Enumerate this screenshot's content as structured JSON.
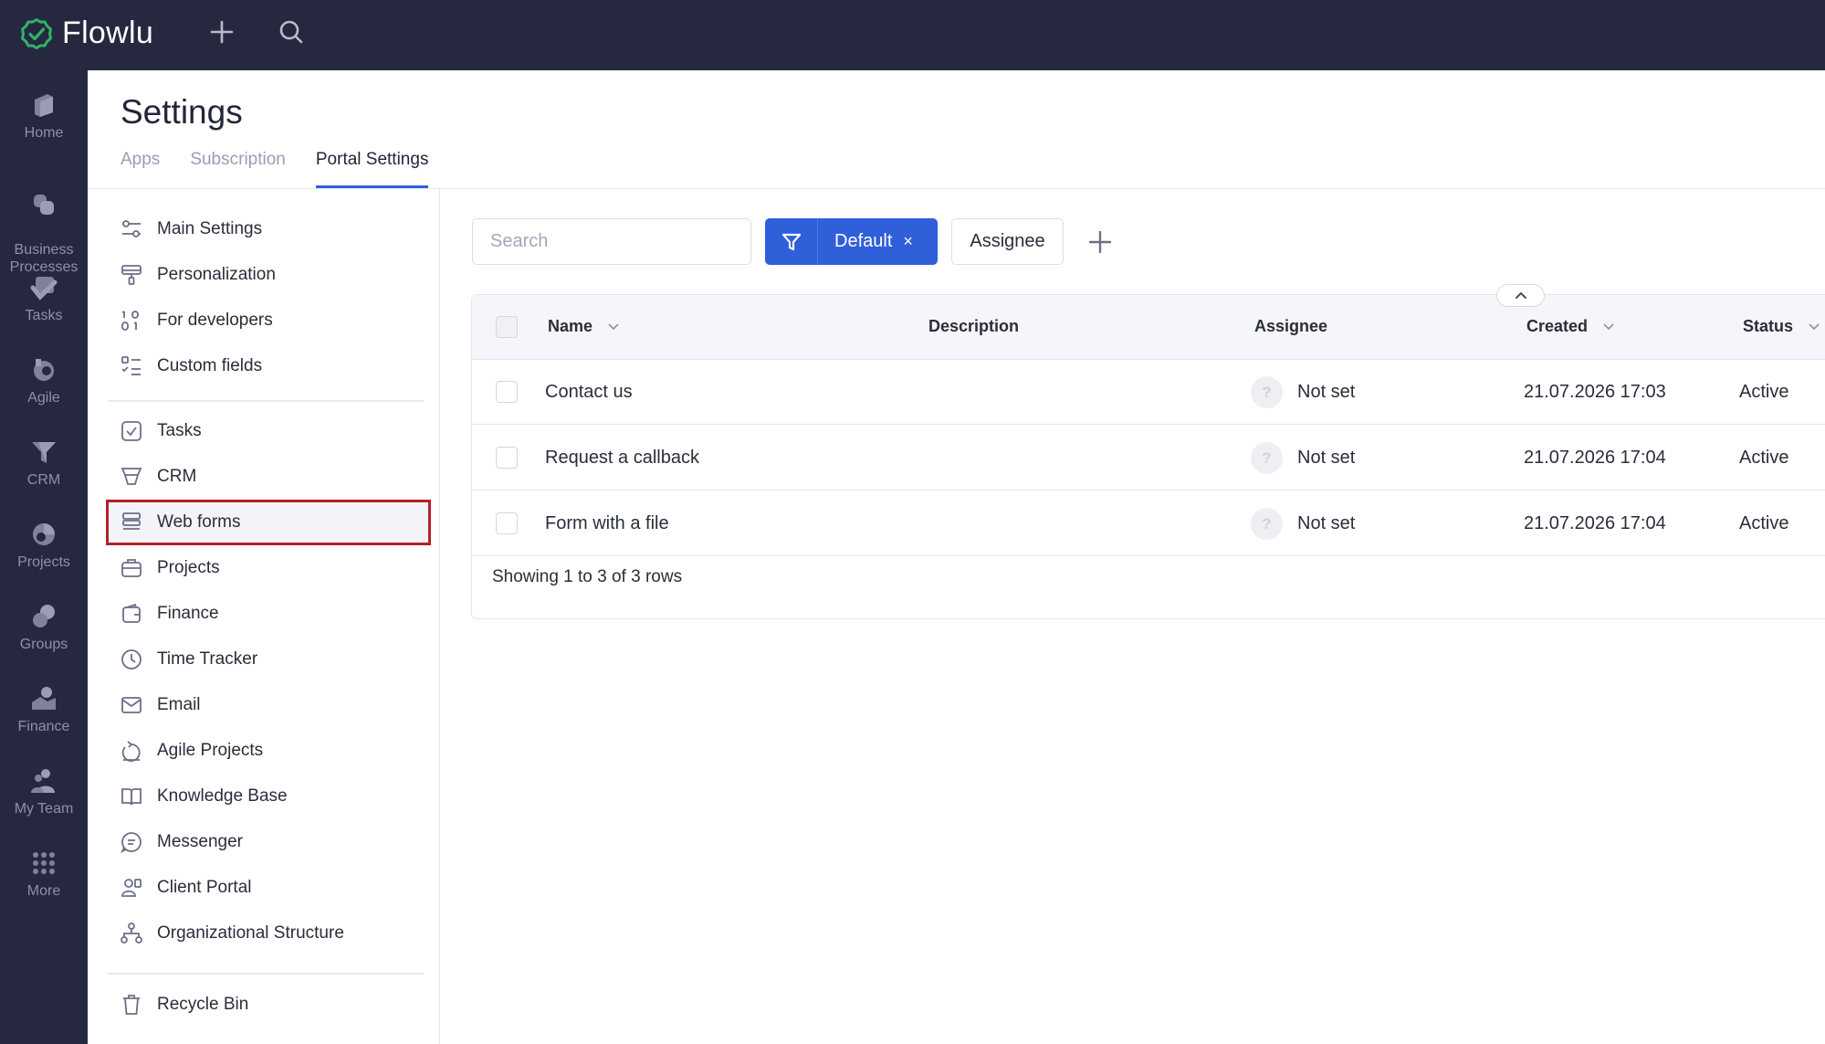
{
  "app": {
    "name": "Flowlu",
    "brand_color": "#262840",
    "accent_color": "#2f5fd9",
    "logo_check_color": "#2fb36a",
    "highlight_color": "#b3202a"
  },
  "topbar": {
    "add_icon": "plus-icon",
    "search_icon": "search-icon"
  },
  "rail": {
    "items": [
      {
        "label": "Home",
        "icon": "home-icon"
      },
      {
        "label": "Business\nProcesses",
        "icon": "business-processes-icon"
      },
      {
        "label": "Tasks",
        "icon": "tasks-icon"
      },
      {
        "label": "Agile",
        "icon": "agile-icon"
      },
      {
        "label": "CRM",
        "icon": "crm-icon"
      },
      {
        "label": "Projects",
        "icon": "projects-icon"
      },
      {
        "label": "Groups",
        "icon": "groups-icon"
      },
      {
        "label": "Finance",
        "icon": "finance-icon"
      },
      {
        "label": "My Team",
        "icon": "my-team-icon"
      },
      {
        "label": "More",
        "icon": "grid-dots-icon"
      }
    ]
  },
  "header": {
    "title": "Settings",
    "tabs": [
      {
        "label": "Apps",
        "active": false
      },
      {
        "label": "Subscription",
        "active": false
      },
      {
        "label": "Portal Settings",
        "active": true
      }
    ]
  },
  "menu": {
    "groups": [
      [
        {
          "label": "Main Settings",
          "icon": "sliders-icon"
        },
        {
          "label": "Personalization",
          "icon": "paint-roller-icon"
        },
        {
          "label": "For developers",
          "icon": "binary-icon"
        },
        {
          "label": "Custom fields",
          "icon": "list-check-icon"
        }
      ],
      [
        {
          "label": "Tasks",
          "icon": "checkbox-icon"
        },
        {
          "label": "CRM",
          "icon": "funnel-icon"
        },
        {
          "label": "Web forms",
          "icon": "form-icon",
          "selected": true
        },
        {
          "label": "Projects",
          "icon": "briefcase-icon"
        },
        {
          "label": "Finance",
          "icon": "wallet-icon"
        },
        {
          "label": "Time Tracker",
          "icon": "clock-icon"
        },
        {
          "label": "Email",
          "icon": "mail-icon"
        },
        {
          "label": "Agile Projects",
          "icon": "agile-icon"
        },
        {
          "label": "Knowledge Base",
          "icon": "book-icon"
        },
        {
          "label": "Messenger",
          "icon": "chat-icon"
        },
        {
          "label": "Client Portal",
          "icon": "user-portal-icon"
        },
        {
          "label": "Organizational Structure",
          "icon": "org-chart-icon"
        }
      ],
      [
        {
          "label": "Recycle Bin",
          "icon": "trash-icon"
        }
      ]
    ]
  },
  "toolbar": {
    "search_placeholder": "Search",
    "filter_label": "Default",
    "filter_close": "×",
    "assignee_label": "Assignee"
  },
  "table": {
    "columns": [
      "Name",
      "Description",
      "Assignee",
      "Created",
      "Status"
    ],
    "rows": [
      {
        "name": "Contact us",
        "description": "",
        "assignee": "Not set",
        "avatar": "?",
        "created": "21.07.2026 17:03",
        "status": "Active"
      },
      {
        "name": "Request a callback",
        "description": "",
        "assignee": "Not set",
        "avatar": "?",
        "created": "21.07.2026 17:04",
        "status": "Active"
      },
      {
        "name": "Form with a file",
        "description": "",
        "assignee": "Not set",
        "avatar": "?",
        "created": "21.07.2026 17:04",
        "status": "Active"
      }
    ],
    "footer": "Showing 1 to 3 of 3 rows"
  }
}
